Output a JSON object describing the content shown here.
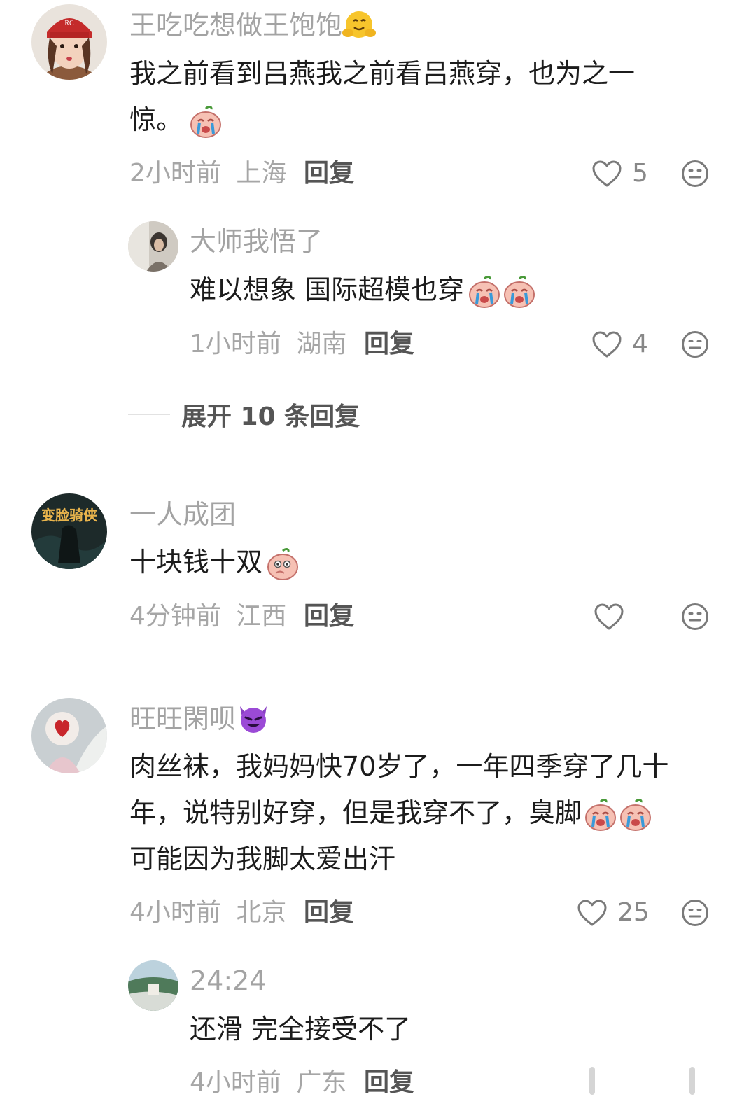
{
  "comments": [
    {
      "username": "王吃吃想做王饱饱",
      "username_emoji": "hugging-face-emoji",
      "text_line1": "我之前看到吕燕我之前看吕燕穿，也为之一",
      "text_line2": "惊。",
      "time": "2小时前",
      "location": "上海",
      "reply_label": "回复",
      "likes": "5"
    },
    {
      "username": "大师我悟了",
      "text": "难以想象 国际超模也穿",
      "time": "1小时前",
      "location": "湖南",
      "reply_label": "回复",
      "likes": "4"
    },
    {
      "username": "一人成团",
      "avatar_text": "变脸骑侠",
      "text": "十块钱十双",
      "time": "4分钟前",
      "location": "江西",
      "reply_label": "回复",
      "likes": ""
    },
    {
      "username": "旺旺閑呗",
      "username_emoji": "smiling-devil-emoji",
      "text_line1": "肉丝袜，我妈妈快70岁了，一年四季穿了几十",
      "text_line2": "年，说特别好穿，但是我穿不了，臭脚",
      "text_line3": "可能因为我脚太爱出汗",
      "time": "4小时前",
      "location": "北京",
      "reply_label": "回复",
      "likes": "25"
    },
    {
      "username": "24:24",
      "text": "还滑 完全接受不了",
      "time": "4小时前",
      "location": "广东",
      "reply_label": "回复"
    }
  ],
  "expand_replies": "展开 10 条回复",
  "colors": {
    "meta": "#a6a6a6",
    "text": "#1c1c1c",
    "reply": "#555555"
  }
}
